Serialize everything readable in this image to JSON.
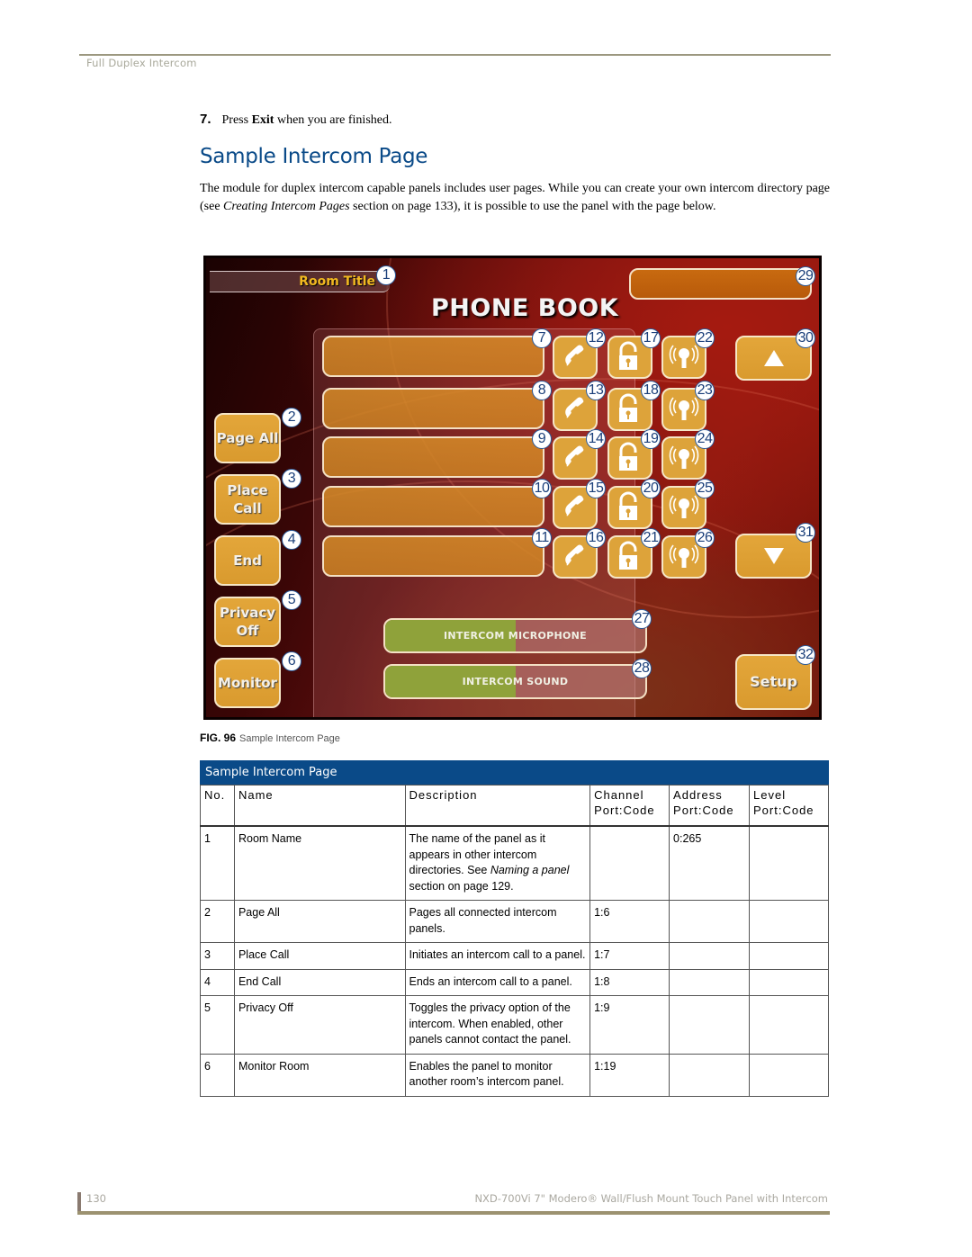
{
  "header": {
    "section_label": "Full Duplex Intercom"
  },
  "step": {
    "number": "7.",
    "text_before": "Press ",
    "bold": "Exit",
    "text_after": " when you are finished."
  },
  "section": {
    "title": "Sample Intercom Page",
    "intro_part1": "The module for duplex intercom capable panels includes user pages. While you can create your own intercom directory page (see ",
    "intro_italic": "Creating Intercom Pages",
    "intro_part2": " section on page 133), it is possible to use the panel with the page below."
  },
  "panel": {
    "room_title": "Room Title",
    "phonebook_title": "PHONE BOOK",
    "left_buttons": [
      {
        "label_line1": "Page All",
        "label_line2": "",
        "callout": "2"
      },
      {
        "label_line1": "Place",
        "label_line2": "Call",
        "callout": "3"
      },
      {
        "label_line1": "End",
        "label_line2": "",
        "callout": "4"
      },
      {
        "label_line1": "Privacy",
        "label_line2": "Off",
        "callout": "5"
      },
      {
        "label_line1": "Monitor",
        "label_line2": "",
        "callout": "6"
      }
    ],
    "entries": [
      {
        "callout": "7",
        "call_callout": "12",
        "door_callout": "17",
        "monitor_callout": "22"
      },
      {
        "callout": "8",
        "call_callout": "13",
        "door_callout": "18",
        "monitor_callout": "23"
      },
      {
        "callout": "9",
        "call_callout": "14",
        "door_callout": "19",
        "monitor_callout": "24"
      },
      {
        "callout": "10",
        "call_callout": "15",
        "door_callout": "20",
        "monitor_callout": "25"
      },
      {
        "callout": "11",
        "call_callout": "16",
        "door_callout": "21",
        "monitor_callout": "26"
      }
    ],
    "room_title_callout": "1",
    "status_callout": "29",
    "scroll_up_callout": "30",
    "scroll_down_callout": "31",
    "setup": {
      "label": "Setup",
      "callout": "32"
    },
    "sliders": [
      {
        "label": "INTERCOM MICROPHONE",
        "level_percent": 50,
        "callout": "27"
      },
      {
        "label": "INTERCOM SOUND",
        "level_percent": 50,
        "callout": "28"
      }
    ],
    "icons": {
      "call": "phone-handset-icon",
      "door": "unlocked-padlock-icon",
      "monitor": "speaker-signal-icon",
      "up": "triangle-up-icon",
      "down": "triangle-down-icon"
    }
  },
  "figure": {
    "label": "FIG. 96",
    "caption": "Sample Intercom Page"
  },
  "table": {
    "title": "Sample Intercom Page",
    "headers": [
      "No.",
      "Name",
      "Description",
      "Channel",
      "Address",
      "Level"
    ],
    "subheaders": [
      "",
      "",
      "",
      "Port:Code",
      "Port:Code",
      "Port:Code"
    ],
    "rows": [
      {
        "no": "1",
        "name": "Room Name",
        "desc_pre": "The name of the panel as it appears in other intercom directories. See ",
        "desc_italic": "Naming a panel",
        "desc_post": " section on page 129.",
        "channel": "",
        "address": "0:265",
        "level": ""
      },
      {
        "no": "2",
        "name": "Page All",
        "desc_pre": "Pages all connected intercom panels.",
        "desc_italic": "",
        "desc_post": "",
        "channel": "1:6",
        "address": "",
        "level": ""
      },
      {
        "no": "3",
        "name": "Place Call",
        "desc_pre": "Initiates an intercom call to a panel.",
        "desc_italic": "",
        "desc_post": "",
        "channel": "1:7",
        "address": "",
        "level": ""
      },
      {
        "no": "4",
        "name": "End Call",
        "desc_pre": "Ends an intercom call to a panel.",
        "desc_italic": "",
        "desc_post": "",
        "channel": "1:8",
        "address": "",
        "level": ""
      },
      {
        "no": "5",
        "name": "Privacy Off",
        "desc_pre": "Toggles the privacy option of the intercom. When enabled, other panels cannot contact the panel.",
        "desc_italic": "",
        "desc_post": "",
        "channel": "1:9",
        "address": "",
        "level": ""
      },
      {
        "no": "6",
        "name": "Monitor Room",
        "desc_pre": "Enables the panel to monitor another room’s intercom panel.",
        "desc_italic": "",
        "desc_post": "",
        "channel": "1:19",
        "address": "",
        "level": ""
      }
    ]
  },
  "footer": {
    "page_number": "130",
    "doc_title": "NXD-700Vi 7\" Modero® Wall/Flush Mount Touch Panel with Intercom"
  }
}
